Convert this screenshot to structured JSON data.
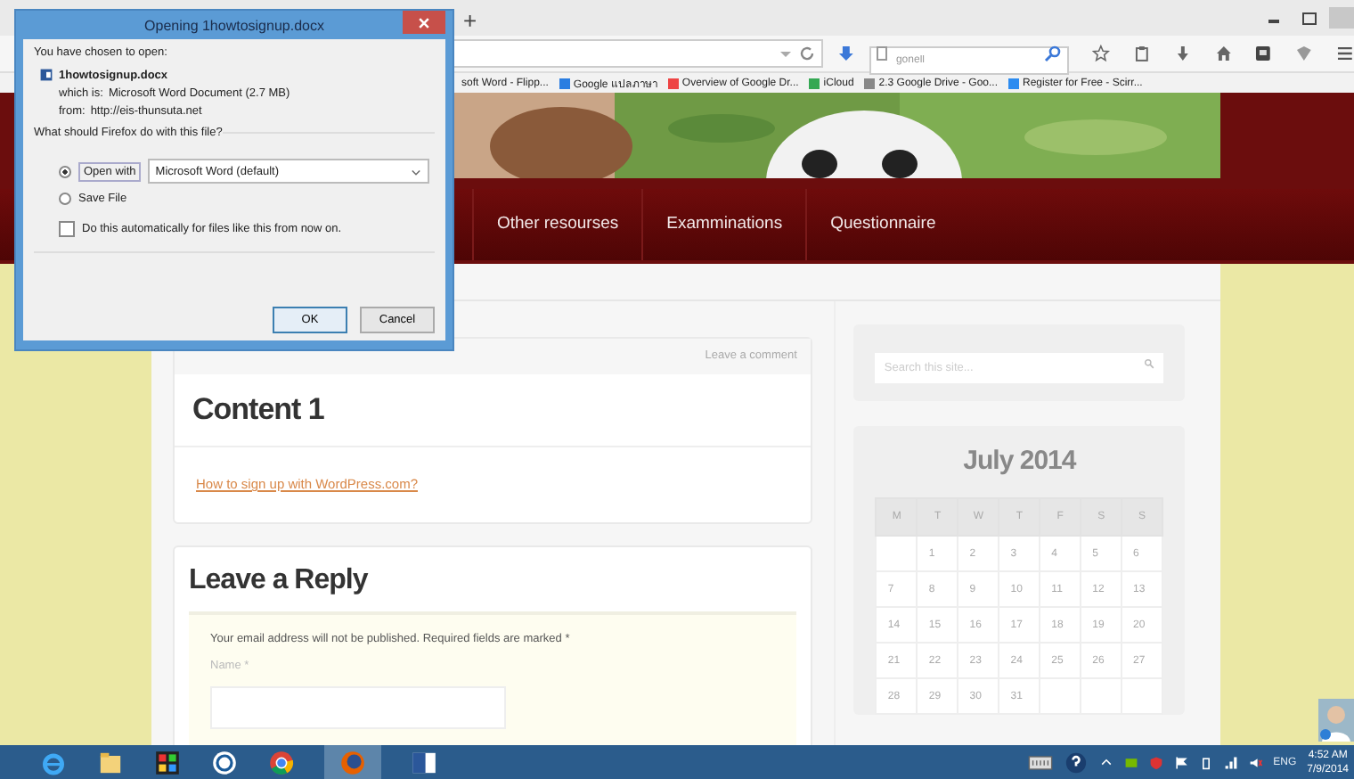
{
  "browser": {
    "new_tab": "+",
    "search": {
      "placeholder": "gonell"
    },
    "bookmarks": [
      {
        "label": "soft Word - Flipp..."
      },
      {
        "label": "Google แปลภาษา"
      },
      {
        "label": "Overview of Google Dr..."
      },
      {
        "label": "iCloud"
      },
      {
        "label": "2.3 Google Drive - Goo..."
      },
      {
        "label": "Register for Free - Scirr..."
      }
    ]
  },
  "site": {
    "menu": [
      "Other resourses",
      "Examminations",
      "Questionnaire"
    ],
    "post": {
      "meta": "Leave a comment",
      "title": "Content 1",
      "link": "How to sign up with WordPress.com?"
    },
    "reply": {
      "title": "Leave a Reply",
      "note": "Your email address will not be published. Required fields are marked *",
      "name_label": "Name *"
    },
    "search": {
      "placeholder": "Search this site..."
    },
    "calendar": {
      "title": "July 2014",
      "weekdays": [
        "M",
        "T",
        "W",
        "T",
        "F",
        "S",
        "S"
      ],
      "weeks": [
        [
          "1",
          "2",
          "3",
          "4",
          "5",
          "6"
        ],
        [
          "7",
          "8",
          "9",
          "10",
          "11",
          "12",
          "13"
        ],
        [
          "14",
          "15",
          "16",
          "17",
          "18",
          "19",
          "20"
        ],
        [
          "21",
          "22",
          "23",
          "24",
          "25",
          "26",
          "27"
        ],
        [
          "28",
          "29",
          "30",
          "31"
        ]
      ]
    }
  },
  "dialog": {
    "title": "Opening 1howtosignup.docx",
    "intro": "You have chosen to open:",
    "file_name": "1howtosignup.docx",
    "which_label": "which is:",
    "which": "Microsoft Word Document (2.7 MB)",
    "from_label": "from:",
    "from": "http://eis-thunsuta.net",
    "question": "What should Firefox do with this file?",
    "options": [
      {
        "kind": "open_with",
        "label": "Open with",
        "selected": true,
        "app": "Microsoft Word (default)"
      },
      {
        "kind": "save",
        "label": "Save File",
        "selected": false
      }
    ],
    "auto": {
      "label": "Do this automatically for files like this from now on.",
      "checked": false
    },
    "buttons": [
      "OK",
      "Cancel"
    ]
  },
  "taskbar": {
    "language": "ENG",
    "time": "4:52 AM",
    "date": "7/9/2014"
  }
}
